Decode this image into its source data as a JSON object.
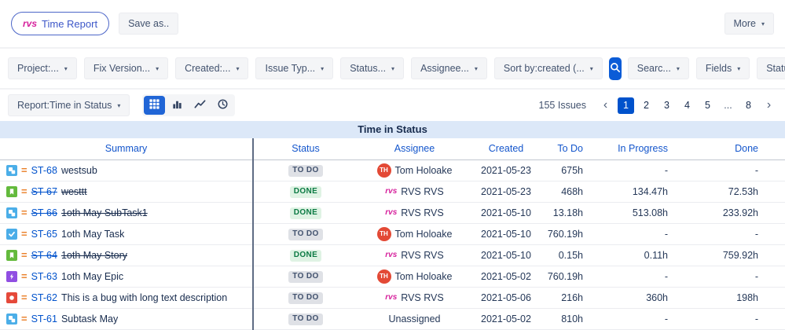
{
  "colors": {
    "accent_blue": "#0052CC",
    "search_button_bg": "#0B5CD7",
    "active_view_bg": "#2065D6",
    "title_band_bg": "#DCE8F8",
    "todo_badge_bg": "#DFE1E6",
    "todo_badge_text": "#42526E",
    "done_badge_bg": "#DFF3E4",
    "done_badge_text": "#0B7A43",
    "brand_magenta": "#D6219C",
    "avatar_red": "#E34935",
    "priority_orange": "#EA7D24"
  },
  "topbar": {
    "brand": "rvs",
    "time_report_label": "Time Report",
    "save_as_label": "Save as..",
    "more_label": "More"
  },
  "filterbar": {
    "left": [
      {
        "id": "project",
        "label": "Project:..."
      },
      {
        "id": "fix-version",
        "label": "Fix Version..."
      },
      {
        "id": "created",
        "label": "Created:..."
      },
      {
        "id": "issue-type",
        "label": "Issue Typ..."
      },
      {
        "id": "status",
        "label": "Status..."
      },
      {
        "id": "assignee",
        "label": "Assignee..."
      },
      {
        "id": "sort-by",
        "label": "Sort by:created (..."
      }
    ],
    "right": [
      {
        "id": "search",
        "label": "Searc..."
      },
      {
        "id": "fields",
        "label": "Fields"
      },
      {
        "id": "statuses",
        "label": "Statuses"
      }
    ]
  },
  "reportbar": {
    "report_label": "Report:Time in Status",
    "views": [
      "table",
      "bar-chart",
      "line-chart",
      "clock"
    ],
    "active_view": "table",
    "issues_count": "155 Issues",
    "pagination": {
      "prev": "‹",
      "pages": [
        "1",
        "2",
        "3",
        "4",
        "5",
        "...",
        "8"
      ],
      "active": "1",
      "next": "›"
    }
  },
  "table": {
    "title": "Time in Status",
    "columns": [
      "Summary",
      "Status",
      "Assignee",
      "Created",
      "To Do",
      "In Progress",
      "Done"
    ],
    "rows": [
      {
        "key": "ST-68",
        "type": "subtask",
        "summary": "westsub",
        "status": "TO DO",
        "assignee": "Tom Holoake",
        "avatar": "TH",
        "avatar_type": "initials",
        "created": "2021-05-23",
        "to_do": "675h",
        "in_progress": "-",
        "done": "-",
        "struck": false
      },
      {
        "key": "ST-67",
        "type": "story",
        "summary": "westtt",
        "status": "DONE",
        "assignee": "RVS RVS",
        "avatar": "rvs",
        "avatar_type": "logo",
        "created": "2021-05-23",
        "to_do": "468h",
        "in_progress": "134.47h",
        "done": "72.53h",
        "struck": true
      },
      {
        "key": "ST-66",
        "type": "subtask",
        "summary": "1oth May SubTask1",
        "status": "DONE",
        "assignee": "RVS RVS",
        "avatar": "rvs",
        "avatar_type": "logo",
        "created": "2021-05-10",
        "to_do": "13.18h",
        "in_progress": "513.08h",
        "done": "233.92h",
        "struck": true
      },
      {
        "key": "ST-65",
        "type": "task",
        "summary": "1oth May Task",
        "status": "TO DO",
        "assignee": "Tom Holoake",
        "avatar": "TH",
        "avatar_type": "initials",
        "created": "2021-05-10",
        "to_do": "760.19h",
        "in_progress": "-",
        "done": "-",
        "struck": false
      },
      {
        "key": "ST-64",
        "type": "story",
        "summary": "1oth May Story",
        "status": "DONE",
        "assignee": "RVS RVS",
        "avatar": "rvs",
        "avatar_type": "logo",
        "created": "2021-05-10",
        "to_do": "0.15h",
        "in_progress": "0.11h",
        "done": "759.92h",
        "struck": true
      },
      {
        "key": "ST-63",
        "type": "epic",
        "summary": "1oth May Epic",
        "status": "TO DO",
        "assignee": "Tom Holoake",
        "avatar": "TH",
        "avatar_type": "initials",
        "created": "2021-05-02",
        "to_do": "760.19h",
        "in_progress": "-",
        "done": "-",
        "struck": false
      },
      {
        "key": "ST-62",
        "type": "bug",
        "summary": "This is a bug with long text description",
        "status": "TO DO",
        "assignee": "RVS RVS",
        "avatar": "rvs",
        "avatar_type": "logo",
        "created": "2021-05-06",
        "to_do": "216h",
        "in_progress": "360h",
        "done": "198h",
        "struck": false
      },
      {
        "key": "ST-61",
        "type": "subtask",
        "summary": "Subtask May",
        "status": "TO DO",
        "assignee": "Unassigned",
        "avatar": "",
        "avatar_type": "none",
        "created": "2021-05-02",
        "to_do": "810h",
        "in_progress": "-",
        "done": "-",
        "struck": false
      }
    ]
  }
}
